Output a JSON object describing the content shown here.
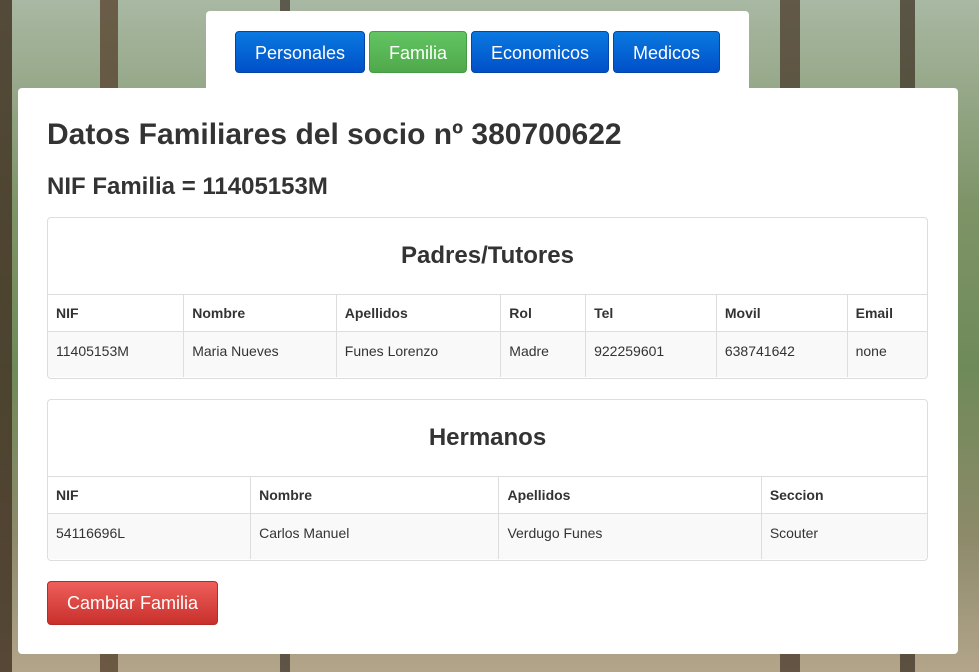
{
  "tabs": {
    "personales": "Personales",
    "familia": "Familia",
    "economicos": "Economicos",
    "medicos": "Medicos",
    "active": "Familia"
  },
  "page": {
    "title": "Datos Familiares del socio nº 380700622",
    "subtitle": "NIF Familia = 11405153M"
  },
  "padres": {
    "title": "Padres/Tutores",
    "headers": [
      "NIF",
      "Nombre",
      "Apellidos",
      "Rol",
      "Tel",
      "Movil",
      "Email"
    ],
    "rows": [
      [
        "11405153M",
        "Maria Nueves",
        "Funes Lorenzo",
        "Madre",
        "922259601",
        "638741642",
        "none"
      ]
    ]
  },
  "hermanos": {
    "title": "Hermanos",
    "headers": [
      "NIF",
      "Nombre",
      "Apellidos",
      "Seccion"
    ],
    "rows": [
      [
        "54116696L",
        "Carlos Manuel",
        "Verdugo Funes",
        "Scouter"
      ]
    ]
  },
  "actions": {
    "change_family": "Cambiar Familia"
  },
  "colors": {
    "tab_blue": "#0a64d6",
    "tab_active_green": "#56b351",
    "button_red": "#d9433e"
  }
}
